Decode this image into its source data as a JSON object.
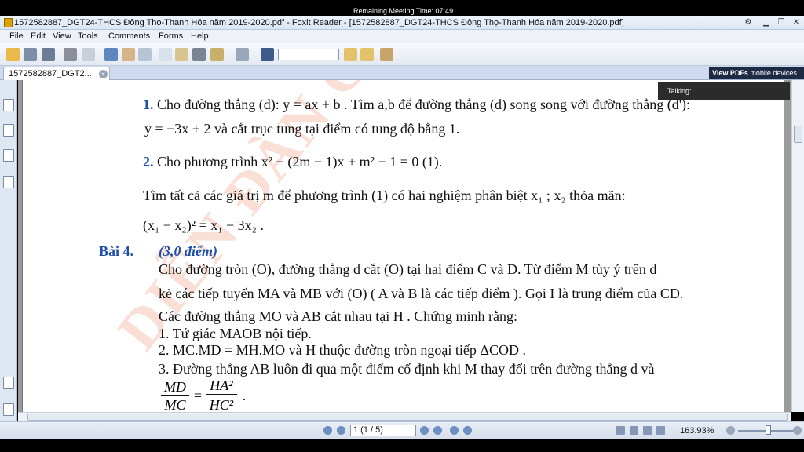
{
  "meeting": {
    "time_label": "Remaining Meeting Time: 07:49",
    "talking_label": "Talking:"
  },
  "window": {
    "title": "1572582887_DGT24-THCS Đông Thọ-Thanh Hóa năm 2019-2020.pdf - Foxit Reader - [1572582887_DGT24-THCS Đông Thọ-Thanh Hóa năm 2019-2020.pdf]"
  },
  "menu": [
    "File",
    "Edit",
    "View",
    "Tools",
    "Comments",
    "Forms",
    "Help"
  ],
  "tab": {
    "label": "1572582887_DGT2..."
  },
  "promo": {
    "bold": "View PDFs",
    "light": " mobile devices"
  },
  "document": {
    "watermark": "DIỄN ĐÀN GIÁO",
    "q1_num": "1.",
    "q1_line1": "Cho đường thẳng (d): y = ax + b . Tìm a,b để đường thẳng (d) song song với đường thẳng (d'):",
    "q1_line2": "y = −3x + 2  và cắt trục tung tại điểm có tung độ bằng 1.",
    "q2_num": "2.",
    "q2_line1": "Cho phương trình x² − (2m − 1)x + m² − 1 = 0        (1).",
    "q2_line2": "Tìm tất cả các giá trị m để phương trình (1) có hai nghiệm phân biệt x₁ ; x₂ thỏa mãn:",
    "q2_line3": "(x₁ − x₂)² = x₁ − 3x₂ .",
    "bai4_label": "Bài 4.",
    "bai4_points": "(3,0 điểm)",
    "b4_line1": "Cho đường tròn (O), đường thẳng d  cắt  (O) tại hai điểm C  và D. Từ điểm M  tùy ý trên d",
    "b4_line2": "kẻ các tiếp tuyến MA  và  MB với (O) ( A và  B là các tiếp điểm ). Gọi I  là trung điểm của CD.",
    "b4_line3": "Các đường thẳng MO  và  AB cắt nhau tại H . Chứng minh rằng:",
    "b4_item1": "1. Tứ giác MAOB nội tiếp.",
    "b4_item2": "2. MC.MD = MH.MO  và H  thuộc đường tròn ngoại tiếp ΔCOD .",
    "b4_item3": "3. Đường thẳng  AB  luôn đi qua một điểm cố định khi  M   thay đổi trên đường thẳng  d và",
    "frac1_num": "MD",
    "frac1_den": "MC",
    "frac_eq": "=",
    "frac2_num": "HA²",
    "frac2_den": "HC²",
    "frac_end": "."
  },
  "status": {
    "page_value": "1 (1 / 5)",
    "zoom": "163.93%"
  }
}
